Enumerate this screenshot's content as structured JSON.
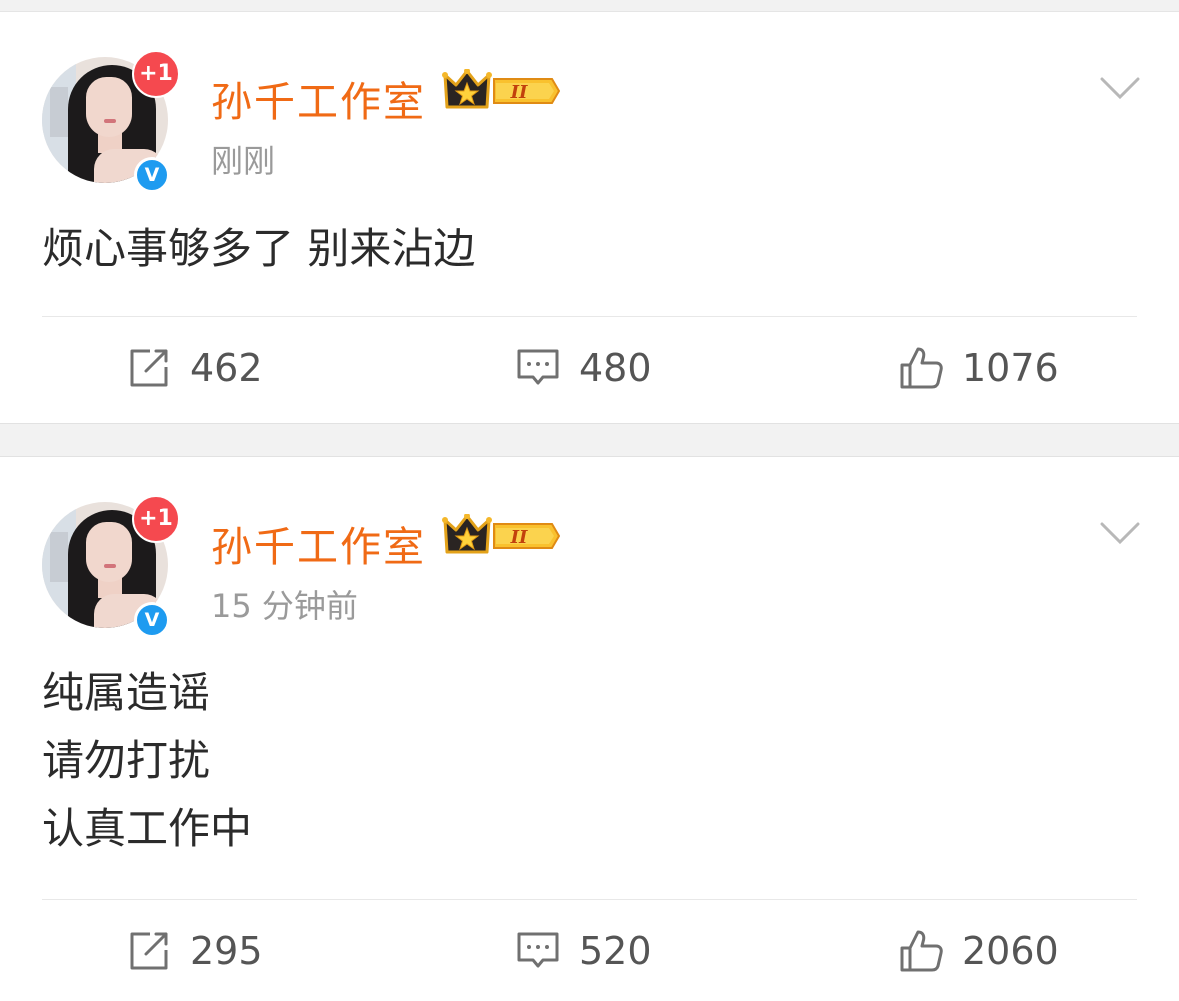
{
  "posts": [
    {
      "author": "孙千工作室",
      "member_level": "II",
      "notification_badge": "+1",
      "verified_badge": "V",
      "time": "刚刚",
      "content_lines": [
        "烦心事够多了 别来沾边"
      ],
      "reposts": "462",
      "comments": "480",
      "likes": "1076"
    },
    {
      "author": "孙千工作室",
      "member_level": "II",
      "notification_badge": "+1",
      "verified_badge": "V",
      "time": "15 分钟前",
      "content_lines": [
        "纯属造谣",
        "请勿打扰",
        "认真工作中"
      ],
      "reposts": "295",
      "comments": "520",
      "likes": "2060"
    }
  ],
  "colors": {
    "author_name": "#f06a15",
    "notification_badge": "#f5494f",
    "verified_badge": "#1e9bf0",
    "crown_gold": "#f4b72a"
  },
  "icons": {
    "repost": "repost-icon",
    "comment": "comment-icon",
    "like": "thumbs-up-icon",
    "menu": "chevron-down-icon"
  }
}
